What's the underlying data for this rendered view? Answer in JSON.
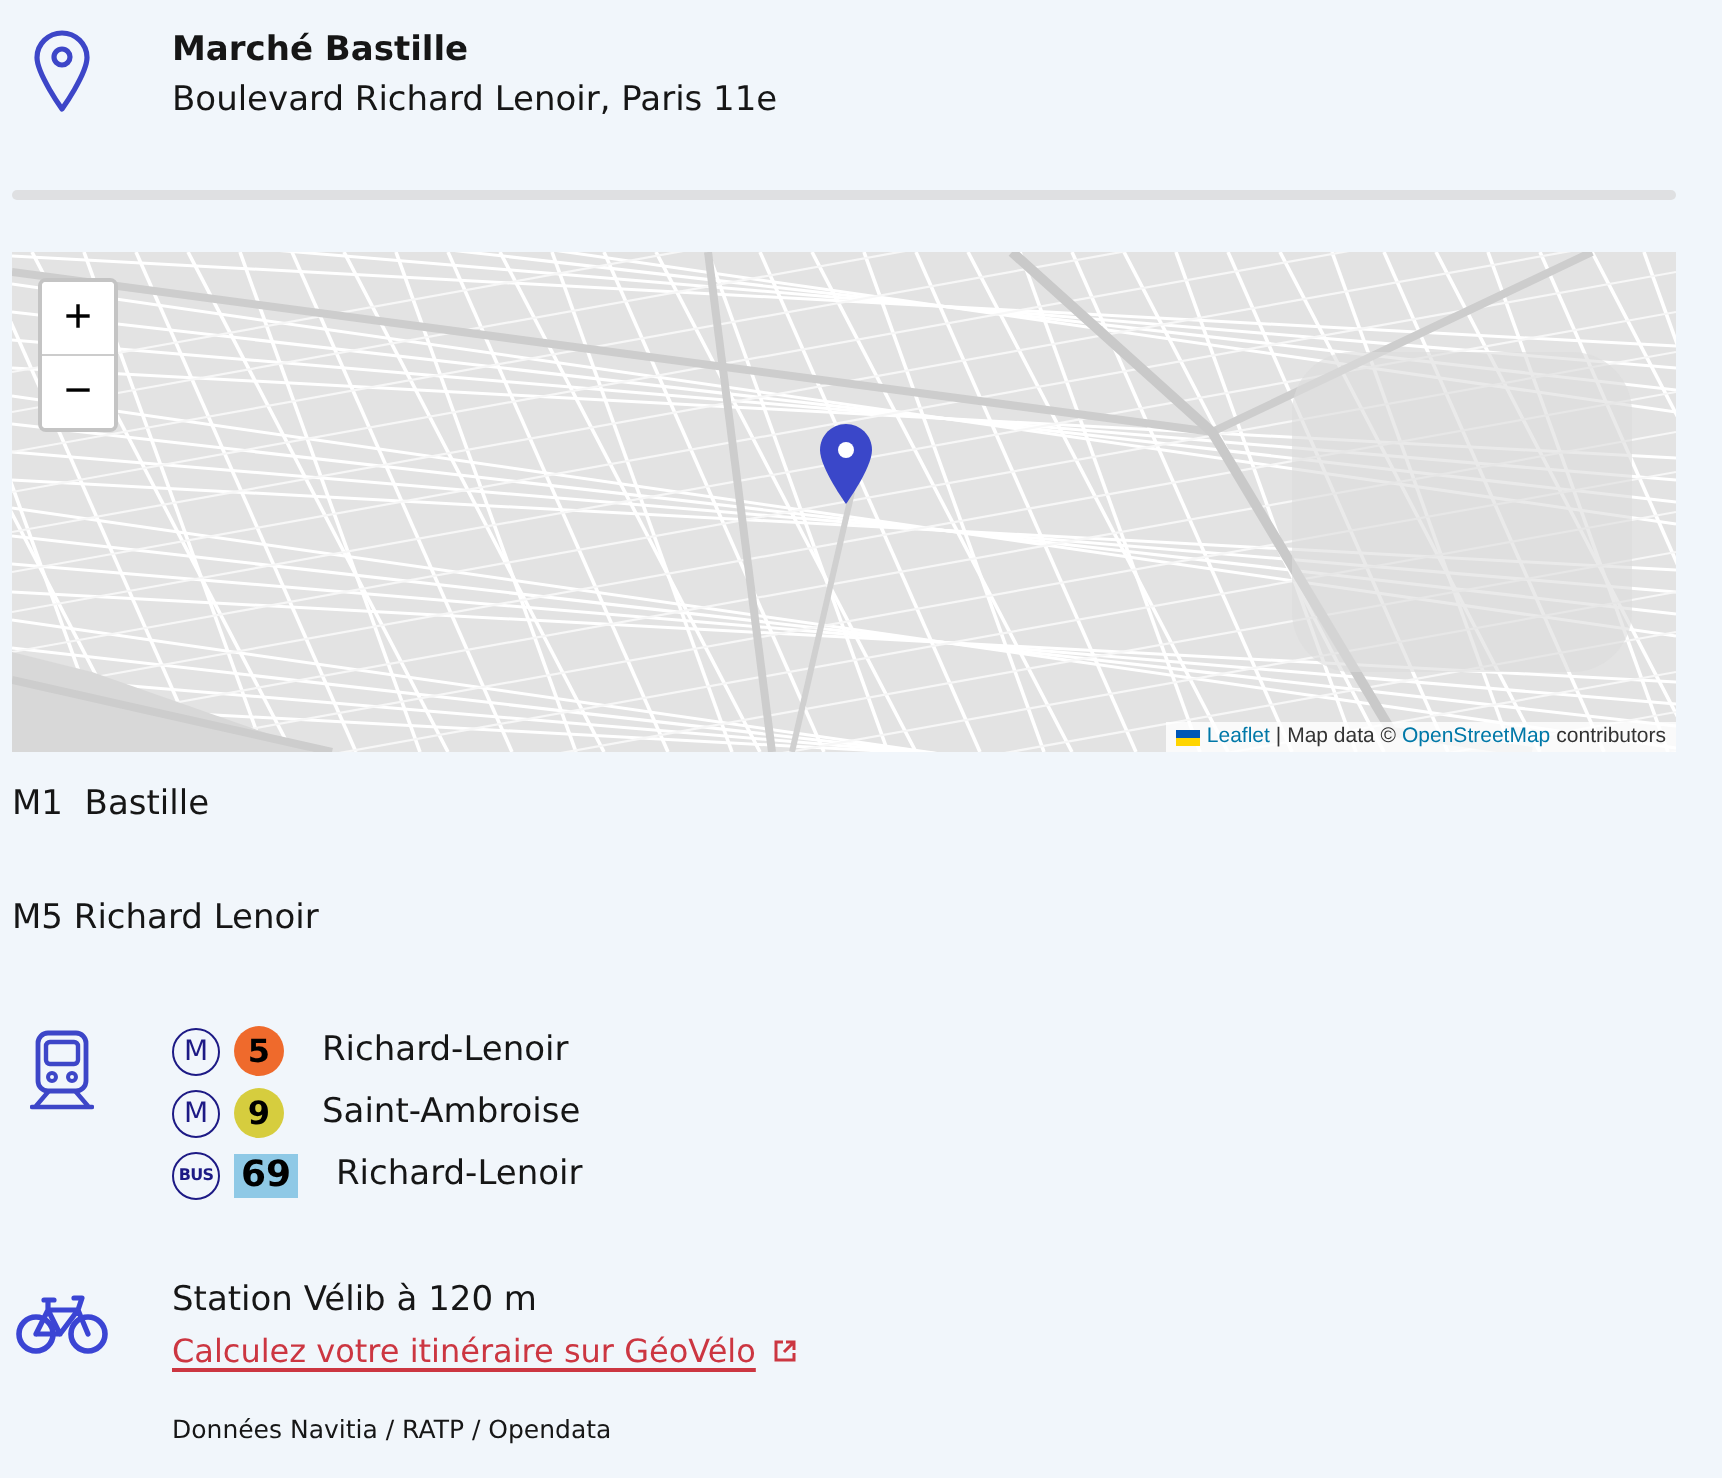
{
  "place": {
    "name": "Marché Bastille",
    "address": "Boulevard Richard Lenoir, Paris 11e"
  },
  "map": {
    "zoom_in": "+",
    "zoom_out": "−",
    "attribution": {
      "leaflet_link": "Leaflet",
      "text_1": "| Map data ©",
      "osm_link": "OpenStreetMap",
      "text_2": "contributors"
    }
  },
  "nearby_stations": [
    "M1  Bastille",
    "M5 Richard Lenoir"
  ],
  "transit": {
    "lines": [
      {
        "kind": "metro",
        "mode": "M",
        "line": "5",
        "color": "#ef6a2c",
        "stop": "Richard-Lenoir"
      },
      {
        "kind": "metro",
        "mode": "M",
        "line": "9",
        "color": "#d6cd3e",
        "stop": "Saint-Ambroise"
      },
      {
        "kind": "bus",
        "mode": "BUS",
        "line": "69",
        "color": "#8fc9e6",
        "stop": "Richard-Lenoir"
      }
    ]
  },
  "bike": {
    "station": "Station Vélib à 120 m",
    "link": "Calculez votre itinéraire sur GéoVélo"
  },
  "source": "Données Navitia / RATP / Opendata"
}
